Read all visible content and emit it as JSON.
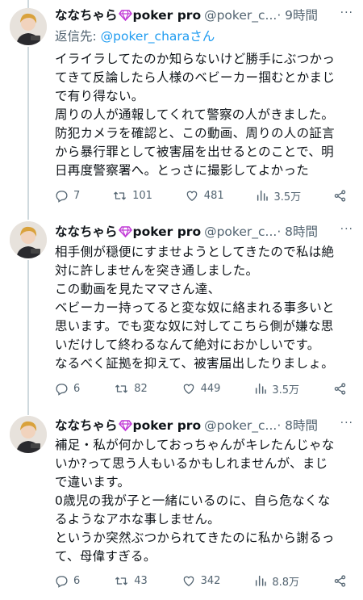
{
  "tweets": [
    {
      "name": "ななちゃら",
      "name_suffix": "poker pro",
      "handle": "@poker_c...",
      "time": "· 9時間",
      "more": "···",
      "reply_prefix": "返信先: ",
      "reply_mention": "@poker_charaさん",
      "lines": [
        "イライラしてたのか知らないけど勝手にぶつかっ",
        "てきて反論したら人様のベビーカー掴むとかまじ",
        "で有り得ない。",
        "周りの人が通報してくれて警察の人がきました。",
        "防犯カメラを確認と、この動画、周りの人の証言",
        "から暴行罪として被害届を出せるとのことで、明",
        "日再度警察署へ。とっさに撮影してよかった"
      ],
      "replies": "7",
      "retweets": "101",
      "likes": "481",
      "views": "3.5万"
    },
    {
      "name": "ななちゃら",
      "name_suffix": "poker pro",
      "handle": "@poker_c...",
      "time": "· 8時間",
      "more": "···",
      "lines": [
        "相手側が穏便にすませようとしてきたので私は絶",
        "対に許しませんを突き通しました。",
        "この動画を見たママさん達、",
        "ベビーカー持ってると変な奴に絡まれる事多いと",
        "思います。でも変な奴に対してこちら側が嫌な思",
        "いだけして終わるなんて絶対におかしいです。",
        "なるべく証拠を抑えて、被害届出したりましょ。"
      ],
      "replies": "6",
      "retweets": "82",
      "likes": "449",
      "views": "3.5万"
    },
    {
      "name": "ななちゃら",
      "name_suffix": "poker pro",
      "handle": "@poker_c...",
      "time": "· 8時間",
      "more": "···",
      "lines": [
        "補足・私が何かしておっちゃんがキレたんじゃな",
        "いか?って思う人もいるかもしれませんが、まじ",
        "で違います。",
        "0歳児の我が子と一緒にいるのに、自ら危なくな",
        "るようなアホな事しません。",
        "というか突然ぶつかられてきたのに私から謝るっ",
        "て、母偉すぎる。"
      ],
      "replies": "6",
      "retweets": "43",
      "likes": "342",
      "views": "8.8万"
    }
  ],
  "colors": {
    "text": "#0f1419",
    "secondary": "#536471",
    "link": "#1d9bf0",
    "gem": "#c13ad6",
    "line": "#cfd9de"
  }
}
